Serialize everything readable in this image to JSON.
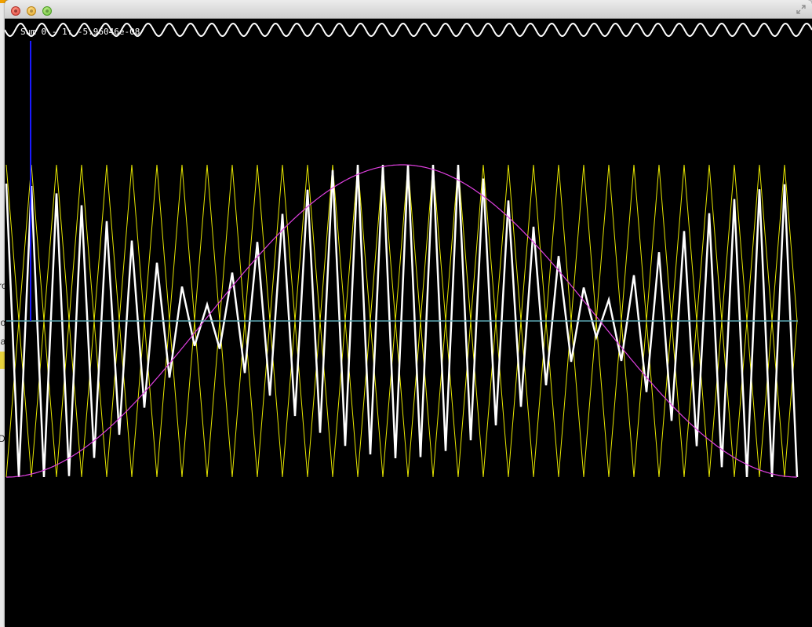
{
  "desktop": {
    "glyphs": [
      "ro",
      "lo",
      "la",
      "D"
    ]
  },
  "window": {
    "title": "",
    "controls": [
      "close-icon",
      "minimize-icon",
      "zoom-icon",
      "fullscreen-icon"
    ]
  },
  "canvas": {
    "label": "Sum 0 - 1: -5.96046e-08",
    "colors": {
      "background": "#000000",
      "sum_wave": "#ffffff",
      "sine_envelope": "#e040e0",
      "triangle_wave": "#e6e600",
      "baseline": "#5aa8b4",
      "marker": "#1a1aff",
      "top_sine": "#ffffff"
    }
  }
}
